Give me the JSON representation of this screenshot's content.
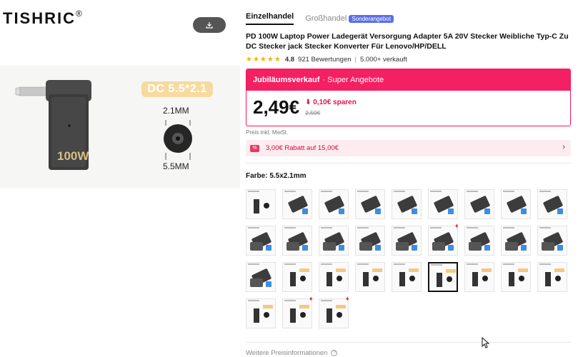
{
  "brand": {
    "name": "TISHRIC",
    "mark": "®"
  },
  "gallery": {
    "dc_label": "DC 5.5*2.1",
    "dim_inner": "2.1MM",
    "dim_outer": "5.5MM",
    "product_text": "100W"
  },
  "tabs": [
    {
      "label": "Einzelhandel"
    },
    {
      "label": "Großhandel"
    }
  ],
  "special_badge": "Sonderangebot",
  "product_title": "PD 100W Laptop Power Ladegerät Versorgung Adapter 5A 20V Stecker Weibliche Typ-C Zu DC Stecker jack Stecker Konverter Für Lenovo/HP/DELL",
  "rating": {
    "stars": "★★★★★",
    "score": "4.8",
    "reviews": "921 Bewertungen",
    "separator": "|",
    "sold": "5.000+ verkauft"
  },
  "deal": {
    "name": "Jubiläumsverkauf",
    "subtitle": "· Super Angebote",
    "price": "2,49€",
    "save": "0,10€ sparen",
    "old_price": "2,59€"
  },
  "tax_note": "Preis inkl. MwSt.",
  "coupon": {
    "icon": "%",
    "text": "3,00€ Rabatt auf 15,00€",
    "arrow": "›"
  },
  "color": {
    "label": "Farbe: 5.5x2.1mm"
  },
  "more_info": "Weitere Preisinformationen",
  "colors": {
    "accent": "#f51f63",
    "badge": "#5b6ee8",
    "tag": "#f6dba0"
  }
}
